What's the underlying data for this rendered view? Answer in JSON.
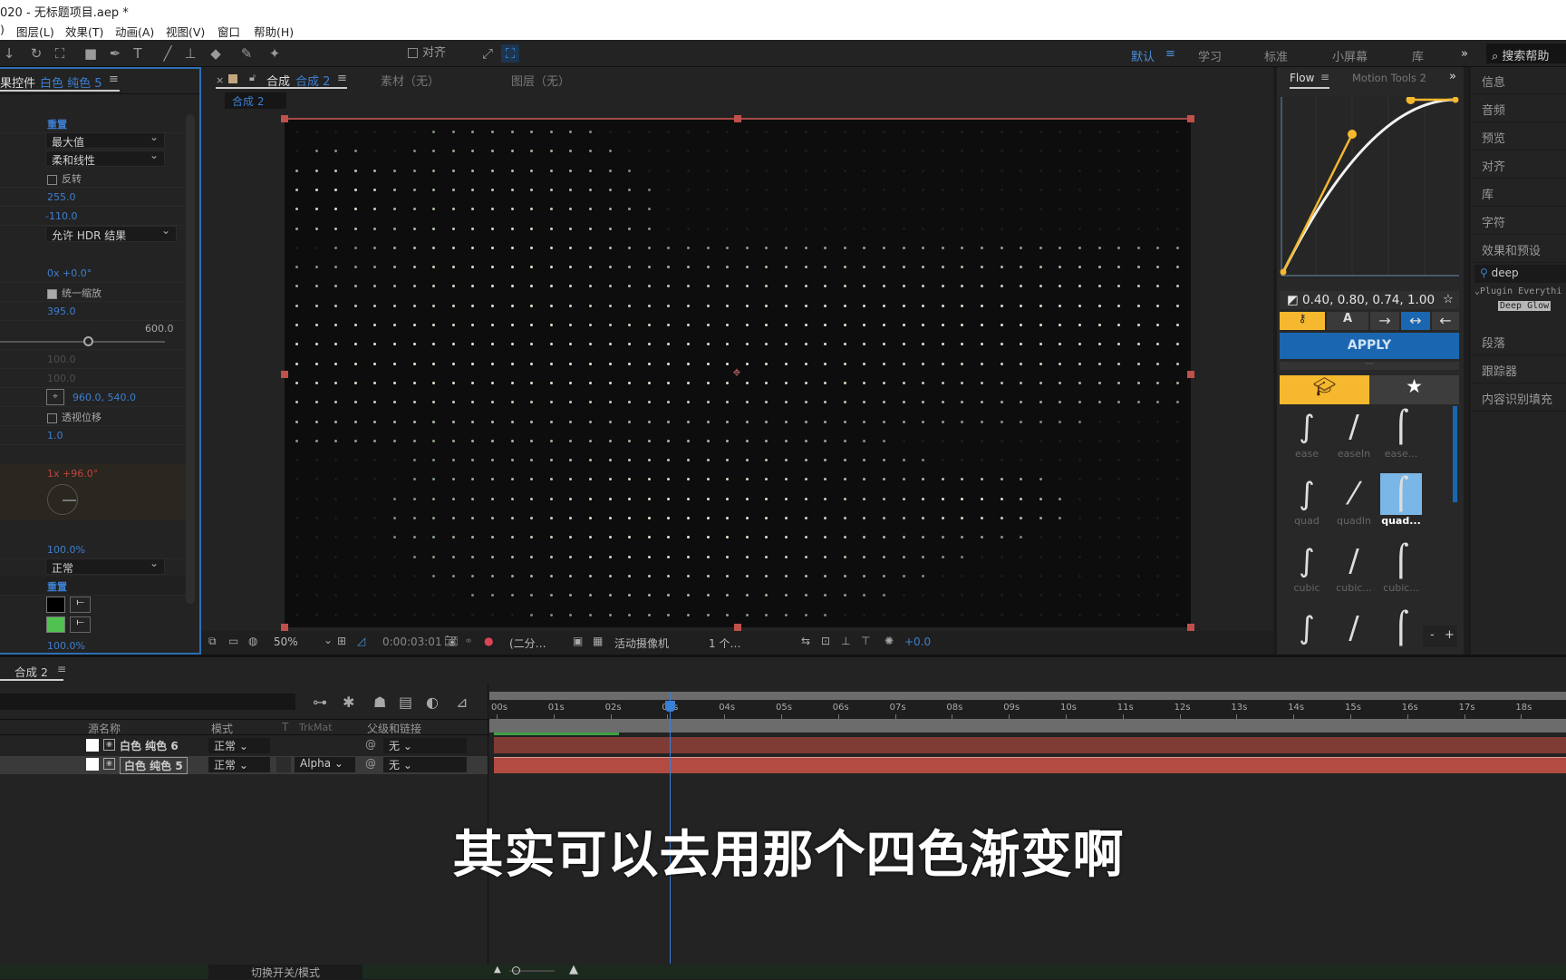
{
  "window": {
    "title": "020 - 无标题项目.aep *"
  },
  "menu": [
    "图层(L)",
    "效果(T)",
    "动画(A)",
    "视图(V)",
    "窗口",
    "帮助(H)"
  ],
  "toolbar": {
    "align_label": "对齐"
  },
  "workspaces": {
    "items": [
      "默认",
      "学习",
      "标准",
      "小屏幕",
      "库"
    ],
    "active": "默认",
    "more": "»",
    "search_placeholder": "搜索帮助"
  },
  "effect_controls": {
    "tab_label": "果控件",
    "layer_name": "白色 纯色 5",
    "reset_label": "重置",
    "mode1": "最大值",
    "mode2": "柔和线性",
    "invert_label": "反转",
    "val1": "255.0",
    "val2": "-110.0",
    "hdr_option": "允许 HDR 结果",
    "rotation_text": "0x +0.0°",
    "uniform_scale_label": "统一缩放",
    "uniform_scale_checked": true,
    "scale_value": "395.0",
    "slider_max": "600.0",
    "slider_fraction": 0.66,
    "dim1": "100.0",
    "dim2": "100.0",
    "center": "960.0, 540.0",
    "perspective_label": "透视位移",
    "val3": "1.0",
    "angle_text": "1x +96.0°",
    "opacity1": "100.0%",
    "blend_mode": "正常",
    "reset_label2": "重置",
    "color1": "#000000",
    "color2": "#4fc24f",
    "opacity2": "100.0%"
  },
  "comp": {
    "tab_prefix": "合成",
    "tab_name": "合成 2",
    "footage_tab": "素材（无）",
    "layer_tab": "图层（无）",
    "breadcrumb": "合成 2",
    "zoom": "50%",
    "timecode": "0:00:03:01",
    "resolution": "(二分…",
    "camera": "活动摄像机",
    "views": "1 个…",
    "exposure": "+0.0"
  },
  "flow": {
    "tab_flow": "Flow",
    "tab_motion": "Motion Tools 2",
    "more": "»",
    "bezier": "0.40, 0.80, 0.74, 1.00",
    "apply": "APPLY",
    "presets": [
      {
        "label": "ease"
      },
      {
        "label": "easeIn"
      },
      {
        "label": "ease..."
      },
      {
        "label": "quad"
      },
      {
        "label": "quadIn"
      },
      {
        "label": "quad...",
        "selected": true
      },
      {
        "label": "cubic"
      },
      {
        "label": "cubic..."
      },
      {
        "label": "cubic..."
      }
    ],
    "minus": "-",
    "plus": "+"
  },
  "right_panel": {
    "items": [
      "信息",
      "音频",
      "预览",
      "对齐",
      "库",
      "字符",
      "效果和预设"
    ],
    "search_value": "deep",
    "tree_group": "Plugin Everythi",
    "tree_item": "Deep Glow",
    "items2": [
      "段落",
      "跟踪器",
      "内容识别填充"
    ]
  },
  "timeline": {
    "tab": "合成 2",
    "columns": {
      "source": "源名称",
      "mode": "模式",
      "t": "T",
      "trkmat": "TrkMat",
      "parent": "父级和链接"
    },
    "layers": [
      {
        "name": "白色 纯色 6",
        "mode": "正常",
        "trkmat": "",
        "parent": "无"
      },
      {
        "name": "白色 纯色 5",
        "mode": "正常",
        "trkmat": "Alpha",
        "parent": "无",
        "selected": true
      }
    ],
    "ruler": [
      "00s",
      "01s",
      "02s",
      "03s",
      "04s",
      "05s",
      "06s",
      "07s",
      "08s",
      "09s",
      "10s",
      "11s",
      "12s",
      "13s",
      "14s",
      "15s",
      "16s",
      "17s",
      "18s"
    ],
    "playhead_seconds": 3.04,
    "work_area_rendered_seconds": 2.2,
    "toggle_label": "切换开关/模式"
  },
  "subtitle": "其实可以去用那个四色渐变啊"
}
